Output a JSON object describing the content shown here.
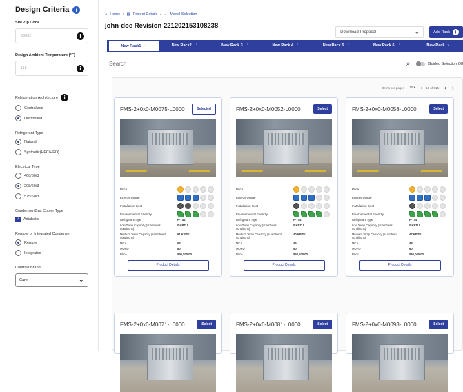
{
  "sidebar": {
    "title": "Design Criteria",
    "zip_label": "Site Zip Code",
    "zip_value": "93032",
    "temp_label": "Design Ambient Temperature (°F)",
    "temp_value": "115",
    "refarch_label": "Refrigeration Architecture",
    "refarch_options": [
      "Centralized",
      "Distributed"
    ],
    "reftype_label": "Refrigerant Type",
    "reftype_options": [
      "Natural",
      "Synthetic(HFC/HFO)"
    ],
    "elec_label": "Electrical Type",
    "elec_options": [
      "460/60/3",
      "208/60/3",
      "575/60/3"
    ],
    "cooler_label": "Condenser/Gas Cooler Type",
    "cooler_option": "Adiabatic",
    "remote_label": "Remote or Integrated Condenser",
    "remote_options": [
      "Remote",
      "Integrated"
    ],
    "brand_label": "Controls Brand",
    "brand_value": "Carel"
  },
  "breadcrumb": {
    "home": "Home",
    "project": "Project Details",
    "model": "Model Selection"
  },
  "page_title": "john-doe Revision 221202153108238",
  "download_label": "Download Proposal",
  "add_rack_label": "Add Rack",
  "tabs": [
    "New Rack1",
    "New Rack2",
    "New Rack 3",
    "New Rack 4",
    "New Rack 5",
    "New Rack 6",
    "New Rack"
  ],
  "search_placeholder": "Search",
  "guided_label": "Guided Selection Off",
  "pager": {
    "per_page_label": "Items per page:",
    "per_page": "10",
    "range": "1 – 10 of 815"
  },
  "spec_labels": {
    "price": "Price",
    "energy": "Energy Usage",
    "install": "Installation Cost",
    "env": "Environmental Friendly",
    "refrigerant": "Refrigerant Type",
    "low": "Low Temp Capacity (at ambient conditions)",
    "medium": "Medium Temp Capacity (at ambient conditions)",
    "mca": "MCA",
    "mopd": "MOPD",
    "price_row": "Price"
  },
  "product_details_label": "Product Details",
  "cards": [
    {
      "name": "FMS-2+0x0-M0075-L0000",
      "select": "Selected",
      "refrigerant": "R-744",
      "low": "0 KBTU",
      "medium": "61 KBTU",
      "mca": "63",
      "mopd": "80",
      "price": "$90,500.00"
    },
    {
      "name": "FMS-2+0x0-M0052-L0000",
      "select": "Select",
      "refrigerant": "R-744",
      "low": "0 KBTU",
      "medium": "40 KBTU",
      "mca": "45",
      "mopd": "50",
      "price": "$58,500.00"
    },
    {
      "name": "FMS-2+0x0-M0058-L0000",
      "select": "Select",
      "refrigerant": "R-744",
      "low": "0 KBTU",
      "medium": "47 KBTU",
      "mca": "48",
      "mopd": "60",
      "price": "$60,000.00"
    },
    {
      "name": "FMS-2+0x0-M0071-L0000",
      "select": "Select"
    },
    {
      "name": "FMS-2+0x0-M0081-L0000",
      "select": "Select"
    },
    {
      "name": "FMS-2+0x0-M0093-L0000",
      "select": "Select"
    }
  ]
}
